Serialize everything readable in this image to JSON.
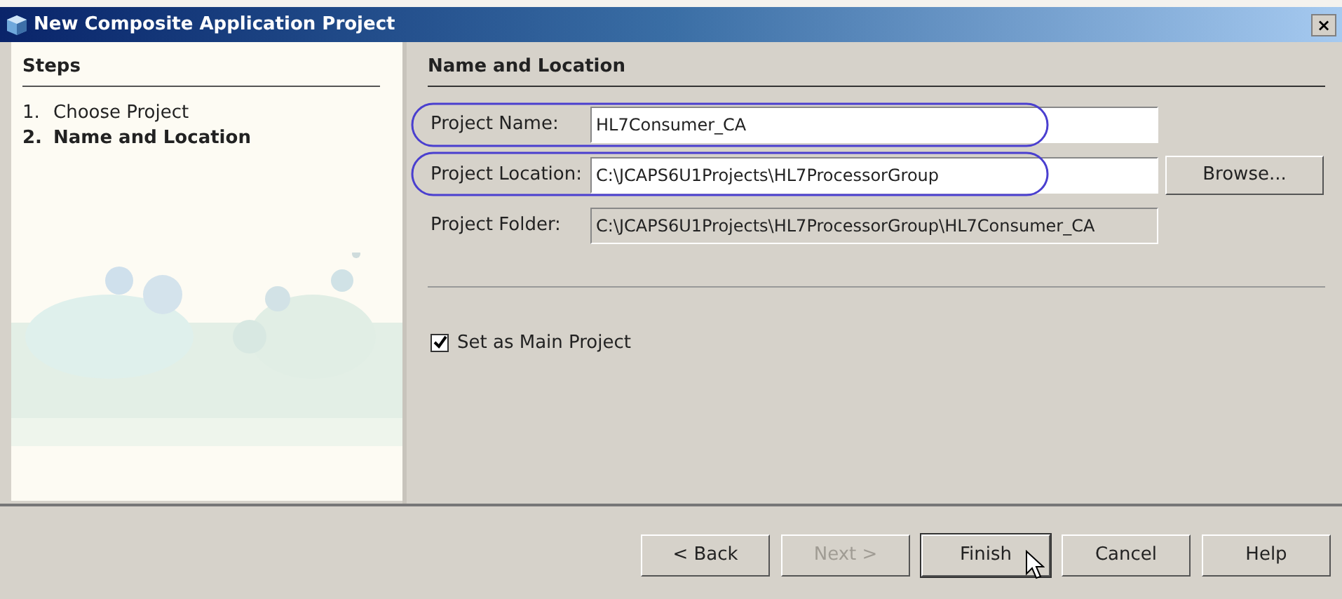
{
  "window": {
    "title": "New Composite Application Project",
    "close": "×"
  },
  "steps": {
    "heading": "Steps",
    "items": [
      {
        "number": "1.",
        "label": "Choose Project",
        "selected": false
      },
      {
        "number": "2.",
        "label": "Name and Location",
        "selected": true
      }
    ]
  },
  "panel": {
    "heading": "Name and Location"
  },
  "fields": [
    {
      "label": "Project Name:",
      "value": "HL7Consumer_CA",
      "editable": true,
      "highlighted": true
    },
    {
      "label": "Project Location:",
      "value": "C:\\JCAPS6U1Projects\\HL7ProcessorGroup",
      "editable": true,
      "highlighted": true,
      "button": "Browse..."
    },
    {
      "label": "Project Folder:",
      "value": "C:\\JCAPS6U1Projects\\HL7ProcessorGroup\\HL7Consumer_CA",
      "editable": false,
      "highlighted": false
    }
  ],
  "main_project": {
    "label": "Set as Main Project",
    "checked": true
  },
  "buttons": [
    {
      "label": "< Back",
      "disabled": false,
      "hovered": false
    },
    {
      "label": "Next >",
      "disabled": true,
      "hovered": false
    },
    {
      "label": "Finish",
      "disabled": false,
      "hovered": true
    },
    {
      "label": "Cancel",
      "disabled": false,
      "hovered": false
    },
    {
      "label": "Help",
      "disabled": false,
      "hovered": false
    }
  ]
}
